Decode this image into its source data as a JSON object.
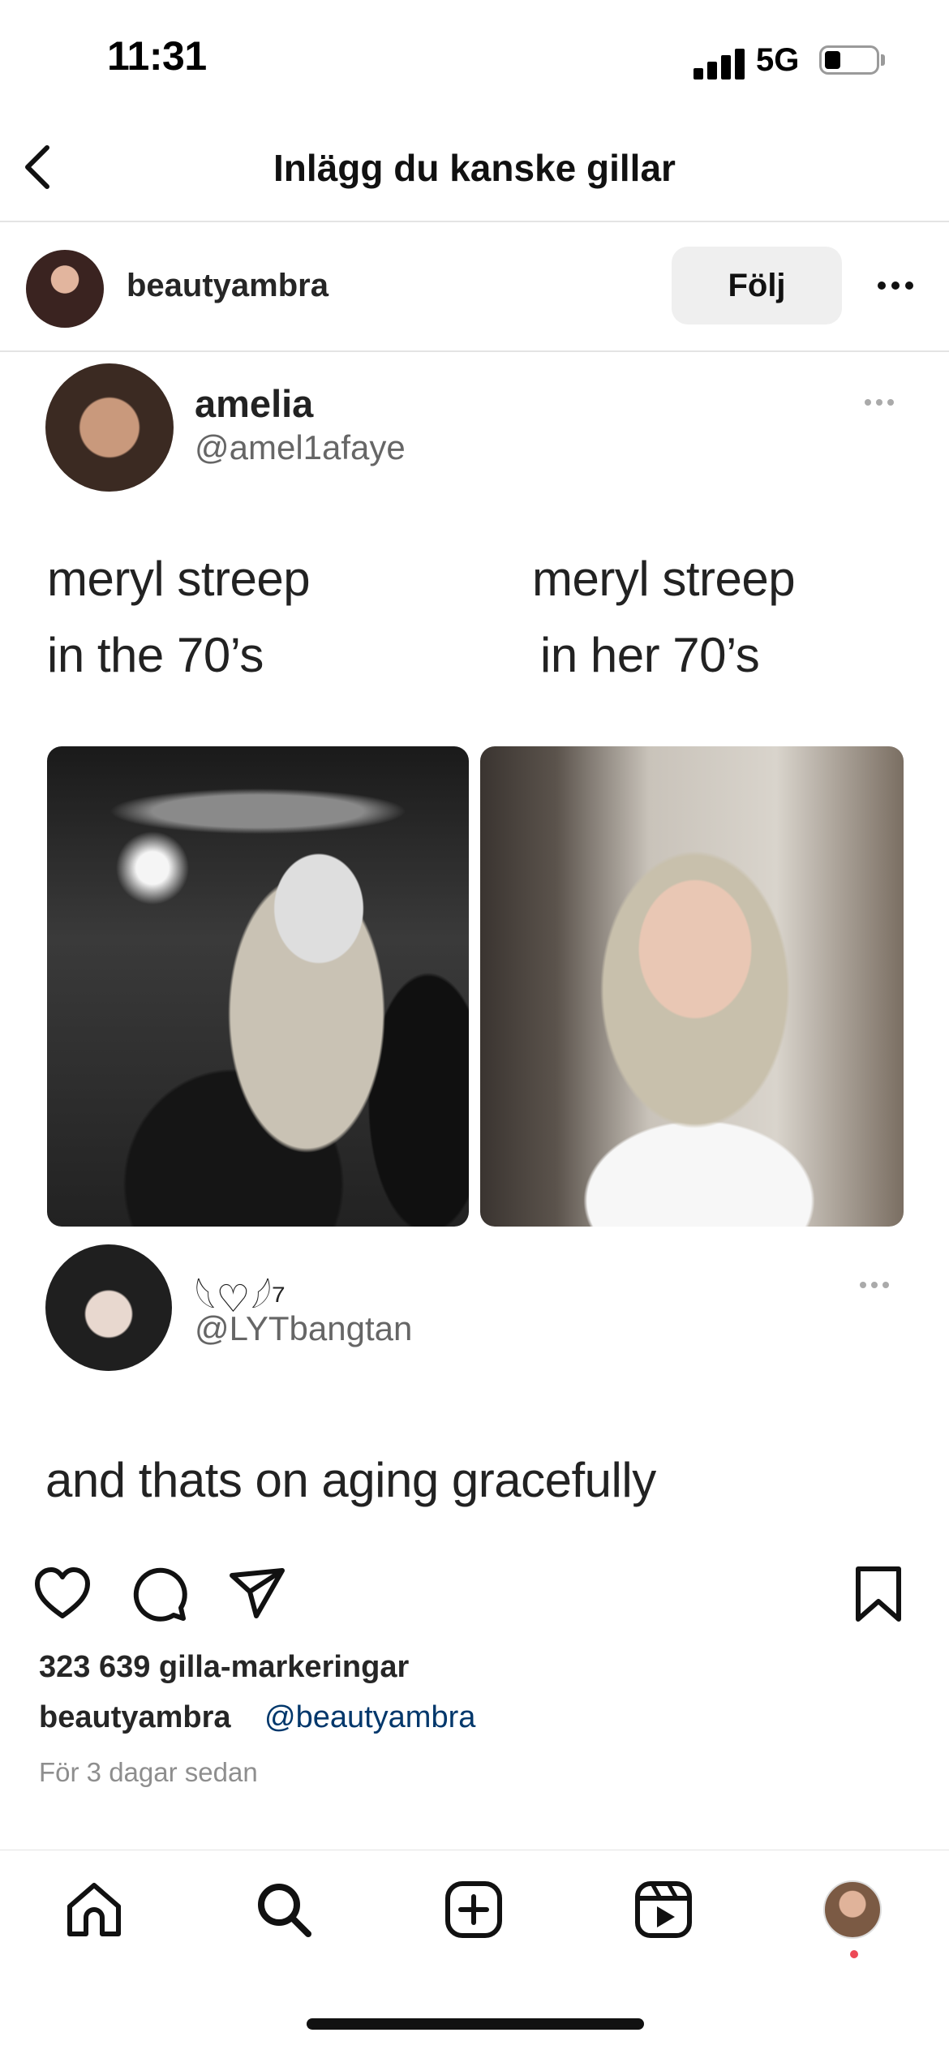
{
  "status_bar": {
    "time": "11:31",
    "network": "5G",
    "battery_level": 0.3
  },
  "header": {
    "title": "Inlägg du kanske gillar"
  },
  "post": {
    "username": "beautyambra",
    "follow_label": "Följ",
    "embedded": {
      "tweet1": {
        "name": "amelia",
        "handle": "@amel1afaye"
      },
      "caption_left_1": "meryl streep",
      "caption_left_2": "in the 70’s",
      "caption_right_1": "meryl streep",
      "caption_right_2": "in her 70’s",
      "tweet2": {
        "name": "𓆩♡𓆪⁷",
        "handle": "@LYTbangtan",
        "text": "and thats on aging gracefully"
      }
    },
    "likes": "323 639 gilla-markeringar",
    "caption_user": "beautyambra",
    "caption_mention": "@beautyambra",
    "timestamp": "För 3 dagar sedan"
  },
  "icons": {
    "back": "chevron-left-icon",
    "like": "heart-icon",
    "comment": "comment-icon",
    "share": "send-icon",
    "save": "bookmark-icon",
    "tabs": [
      "home-icon",
      "search-icon",
      "new-post-icon",
      "reels-icon",
      "profile-avatar"
    ]
  },
  "colors": {
    "mention": "#00376b",
    "notification": "#ed4956",
    "follow_bg": "#efefef"
  }
}
